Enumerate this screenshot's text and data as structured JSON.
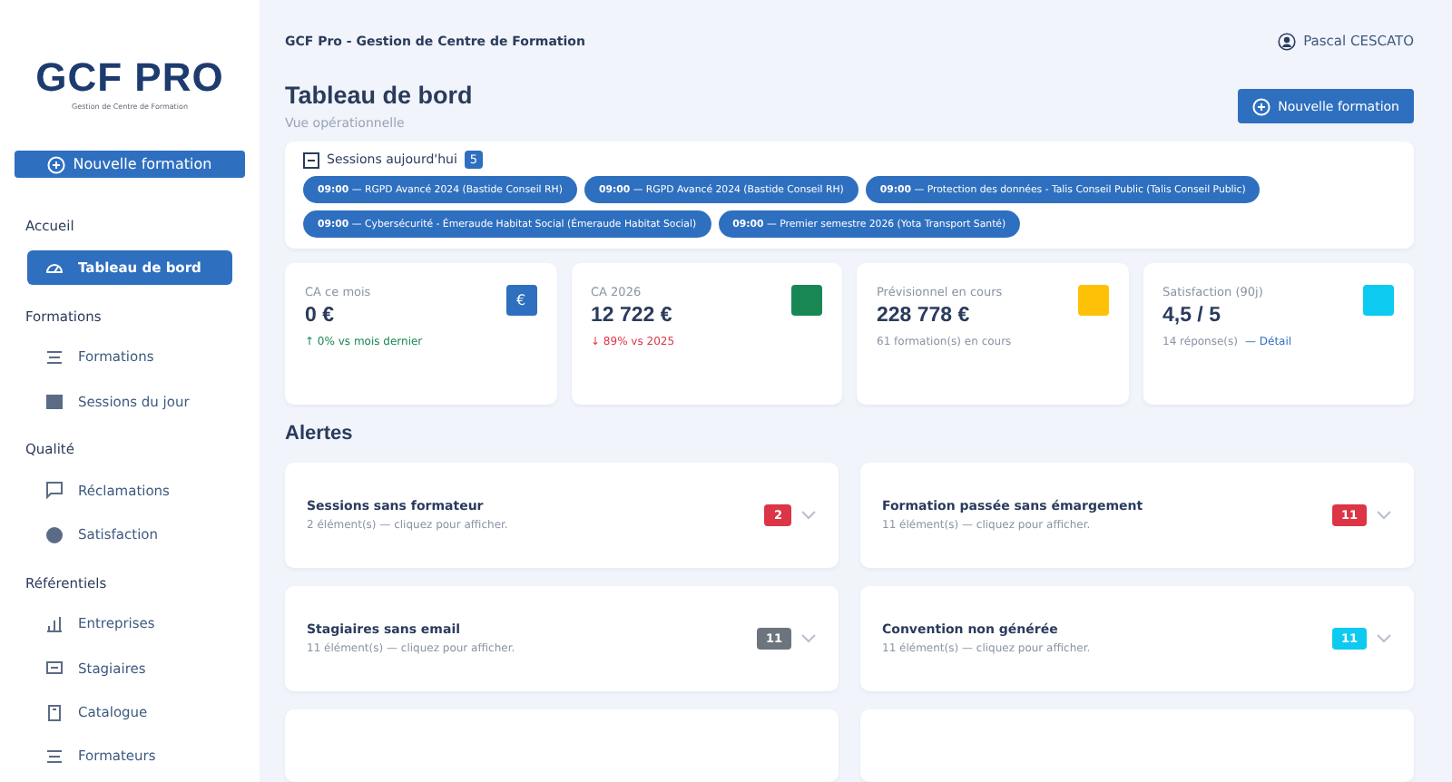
{
  "sidebar": {
    "logo": {
      "title": "GCF PRO",
      "subtitle": "Gestion de Centre de Formation"
    },
    "new_button": "Nouvelle formation",
    "sections": [
      {
        "title": "Accueil",
        "items": [
          {
            "label": "Tableau de bord",
            "kind": "gauge",
            "selected": true
          }
        ]
      },
      {
        "title": "Formations",
        "items": [
          {
            "label": "Formations",
            "kind": "list",
            "selected": false
          },
          {
            "label": "Sessions du jour",
            "kind": "calendar",
            "selected": false
          }
        ]
      },
      {
        "title": "Qualité",
        "items": [
          {
            "label": "Réclamations",
            "kind": "chat",
            "selected": false
          },
          {
            "label": "Satisfaction",
            "kind": "smile",
            "selected": false
          }
        ]
      },
      {
        "title": "Référentiels",
        "items": [
          {
            "label": "Entreprises",
            "kind": "building",
            "selected": false
          },
          {
            "label": "Stagiaires",
            "kind": "people",
            "selected": false
          },
          {
            "label": "Catalogue",
            "kind": "book",
            "selected": false
          },
          {
            "label": "Formateurs",
            "kind": "list",
            "selected": false
          }
        ]
      }
    ]
  },
  "topbar": {
    "title": "GCF Pro - Gestion de Centre de Formation",
    "user": "Pascal CESCATO"
  },
  "header": {
    "title": "Tableau de bord",
    "subtitle": "Vue opérationnelle",
    "button": "Nouvelle formation"
  },
  "sessions": {
    "title": "Sessions aujourd'hui",
    "count": "5",
    "items": [
      {
        "time": "09:00",
        "text": "— RGPD Avancé 2024 (Bastide Conseil RH)"
      },
      {
        "time": "09:00",
        "text": "— RGPD Avancé 2024 (Bastide Conseil RH)"
      },
      {
        "time": "09:00",
        "text": "— Protection des données - Talis Conseil Public (Talis Conseil Public)"
      },
      {
        "time": "09:00",
        "text": "— Cybersécurité - Émeraude Habitat Social (Émeraude Habitat Social)"
      },
      {
        "time": "09:00",
        "text": "— Premier semestre 2026 (Yota Transport Santé)"
      }
    ]
  },
  "stats": [
    {
      "label": "CA ce mois",
      "value": "0 €",
      "icon_text": "€",
      "color": "#2e6fbf",
      "note": "↑ 0% vs mois dernier",
      "kind": "up"
    },
    {
      "label": "CA 2026",
      "value": "12 722 €",
      "color": "#198754",
      "note": "↓ 89% vs 2025",
      "kind": "down"
    },
    {
      "label": "Prévisionnel en cours",
      "value": "228 778 €",
      "color": "#ffc107",
      "note": "61 formation(s) en cours",
      "kind": "plain"
    },
    {
      "label": "Satisfaction (90j)",
      "value": "4,5 / 5",
      "color": "#0dcaf0",
      "note": "14 réponse(s)",
      "link": "— Détail",
      "kind": "plain"
    }
  ],
  "alerts_title": "Alertes",
  "alerts": [
    {
      "title": "Sessions sans formateur",
      "detail": "2 élément(s) — cliquez pour afficher.",
      "count": "2",
      "color": "#dc3545"
    },
    {
      "title": "Formation passée sans émargement",
      "detail": "11 élément(s) — cliquez pour afficher.",
      "count": "11",
      "color": "#dc3545"
    },
    {
      "title": "Stagiaires sans email",
      "detail": "11 élément(s) — cliquez pour afficher.",
      "count": "11",
      "color": "#6c757d"
    },
    {
      "title": "Convention non générée",
      "detail": "11 élément(s) — cliquez pour afficher.",
      "count": "11",
      "color": "#0dcaf0"
    }
  ]
}
